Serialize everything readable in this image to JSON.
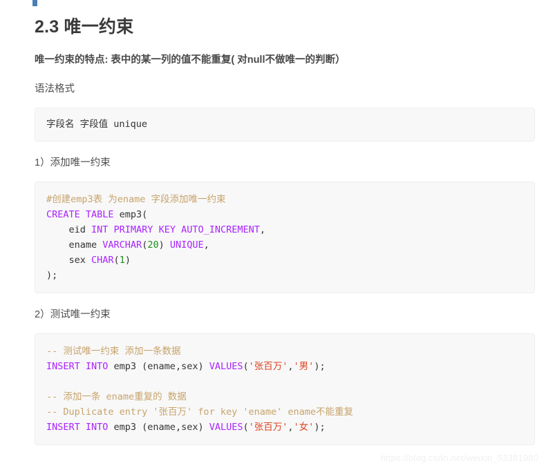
{
  "document": {
    "title": "2.3 唯一约束",
    "lead": "唯一约束的特点: 表中的某一列的值不能重复( 对null不做唯一的判断）",
    "syntax_heading": "语法格式",
    "step1_heading": "1）添加唯一约束",
    "step2_heading": "2）测试唯一约束"
  },
  "marker": {
    "color": "#4a7fb5"
  },
  "code_blocks": {
    "syntax": {
      "text": "字段名 字段值 unique"
    },
    "create": {
      "lines": [
        [
          {
            "t": "#创建emp3表 为ename 字段添加唯一约束",
            "c": "comment"
          }
        ],
        [
          {
            "t": "CREATE TABLE",
            "c": "kw"
          },
          {
            "t": " emp3(",
            "c": "plain"
          }
        ],
        [
          {
            "t": "    eid ",
            "c": "plain"
          },
          {
            "t": "INT PRIMARY KEY AUTO_INCREMENT",
            "c": "kw"
          },
          {
            "t": ",",
            "c": "punct"
          }
        ],
        [
          {
            "t": "    ename ",
            "c": "plain"
          },
          {
            "t": "VARCHAR",
            "c": "kw"
          },
          {
            "t": "(",
            "c": "punct"
          },
          {
            "t": "20",
            "c": "num"
          },
          {
            "t": ") ",
            "c": "punct"
          },
          {
            "t": "UNIQUE",
            "c": "kw"
          },
          {
            "t": ",",
            "c": "punct"
          }
        ],
        [
          {
            "t": "    sex ",
            "c": "plain"
          },
          {
            "t": "CHAR",
            "c": "kw"
          },
          {
            "t": "(",
            "c": "punct"
          },
          {
            "t": "1",
            "c": "num"
          },
          {
            "t": ")",
            "c": "punct"
          }
        ],
        [
          {
            "t": ");",
            "c": "plain"
          }
        ]
      ]
    },
    "test": {
      "lines": [
        [
          {
            "t": "-- 测试唯一约束 添加一条数据",
            "c": "comment"
          }
        ],
        [
          {
            "t": "INSERT INTO",
            "c": "kw"
          },
          {
            "t": " emp3 (ename,sex) ",
            "c": "plain"
          },
          {
            "t": "VALUES",
            "c": "kw"
          },
          {
            "t": "(",
            "c": "punct"
          },
          {
            "t": "'张百万'",
            "c": "str"
          },
          {
            "t": ",",
            "c": "punct"
          },
          {
            "t": "'男'",
            "c": "str"
          },
          {
            "t": ");",
            "c": "punct"
          }
        ],
        [
          {
            "t": "",
            "c": "plain"
          }
        ],
        [
          {
            "t": "-- 添加一条 ename重复的 数据",
            "c": "comment"
          }
        ],
        [
          {
            "t": "-- Duplicate entry '张百万' for key 'ename' ename不能重复",
            "c": "comment"
          }
        ],
        [
          {
            "t": "INSERT INTO",
            "c": "kw"
          },
          {
            "t": " emp3 (ename,sex) ",
            "c": "plain"
          },
          {
            "t": "VALUES",
            "c": "kw"
          },
          {
            "t": "(",
            "c": "punct"
          },
          {
            "t": "'张百万'",
            "c": "str"
          },
          {
            "t": ",",
            "c": "punct"
          },
          {
            "t": "'女'",
            "c": "str"
          },
          {
            "t": ");",
            "c": "punct"
          }
        ]
      ]
    }
  },
  "watermark": {
    "text": "https://blog.csdn.net/weixin_53381980"
  },
  "colors": {
    "keyword": "#aa22ff",
    "number": "#1a8f1a",
    "string": "#dd4422",
    "comment": "#c7a36b",
    "plain": "#333333",
    "code_bg": "#f8f8f8",
    "code_border": "#eeeeee",
    "marker_blue": "#4a7fb5"
  }
}
